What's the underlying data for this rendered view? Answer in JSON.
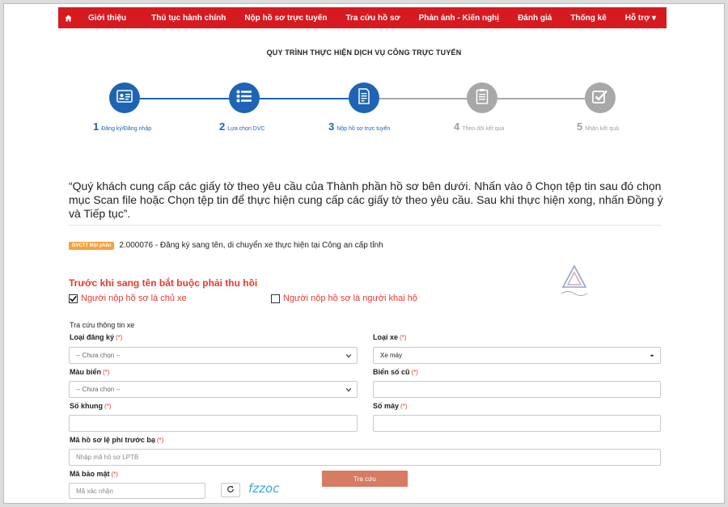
{
  "nav": {
    "items": [
      "Giới thiệu",
      "Thủ tục hành chính",
      "Nộp hồ sơ trực tuyến",
      "Tra cứu hồ sơ",
      "Phản ánh - Kiến nghị",
      "Đánh giá",
      "Thống kê",
      "Hỗ trợ ▾"
    ],
    "home_icon": "home-icon",
    "color": "#d71920"
  },
  "process": {
    "title": "QUY TRÌNH THỰC HIỆN DỊCH VỤ CÔNG TRỰC TUYẾN",
    "steps": [
      {
        "num": "1",
        "label": "Đăng ký/Đăng nhập",
        "icon": "id-card-icon",
        "active": true
      },
      {
        "num": "2",
        "label": "Lựa chọn DVC",
        "icon": "list-icon",
        "active": true
      },
      {
        "num": "3",
        "label": "Nộp hồ sơ trực tuyến",
        "icon": "document-icon",
        "active": true
      },
      {
        "num": "4",
        "label": "Theo dõi kết quả",
        "icon": "clipboard-icon",
        "active": false
      },
      {
        "num": "5",
        "label": "Nhận kết quả",
        "icon": "checkbox-icon",
        "active": false
      }
    ],
    "active_color": "#1e64b4",
    "inactive_color": "#a8a8a8"
  },
  "instruction": "“Quý khách cung cấp các giấy tờ theo yêu cầu của Thành phần hồ sơ bên dưới. Nhấn vào ô Chọn tệp tin sau đó chọn mục Scan file hoặc Chọn tệp tin để thực hiện cung cấp các giấy tờ theo yêu cầu. Sau khi thực hiện xong, nhấn Đồng ý và Tiếp tục”.",
  "service": {
    "badge": "DVCTT Một phần",
    "text": "2.000076 - Đăng ký sang tên, di chuyển xe thực hiện tại Công an cấp tỉnh"
  },
  "recall": {
    "title": "Trước khi sang tên bắt buộc phải thu hồi",
    "option_owner": "Người nộp hồ sơ là chủ xe",
    "option_owner_checked": true,
    "option_proxy": "Người nộp hồ sơ là người khai hộ",
    "option_proxy_checked": false
  },
  "form": {
    "section": "Tra cứu thông tin xe",
    "req_mark": "(*)",
    "reg_type_label": "Loại đăng ký",
    "reg_type_value": "-- Chưa chọn --",
    "vehicle_type_label": "Loại xe",
    "vehicle_type_value": "Xe máy",
    "plate_color_label": "Màu biển",
    "plate_color_value": "-- Chưa chọn --",
    "old_plate_label": "Biển số cũ",
    "frame_no_label": "Số khung",
    "engine_no_label": "Số máy",
    "fee_code_label": "Mã hồ sơ lệ phí trước bạ",
    "fee_code_placeholder": "Nhập mã hồ sơ LPTB",
    "captcha_label": "Mã bảo mật",
    "captcha_placeholder": "Mã xác nhận",
    "captcha_text": "fzzoc",
    "search_button": "Tra cứu"
  }
}
